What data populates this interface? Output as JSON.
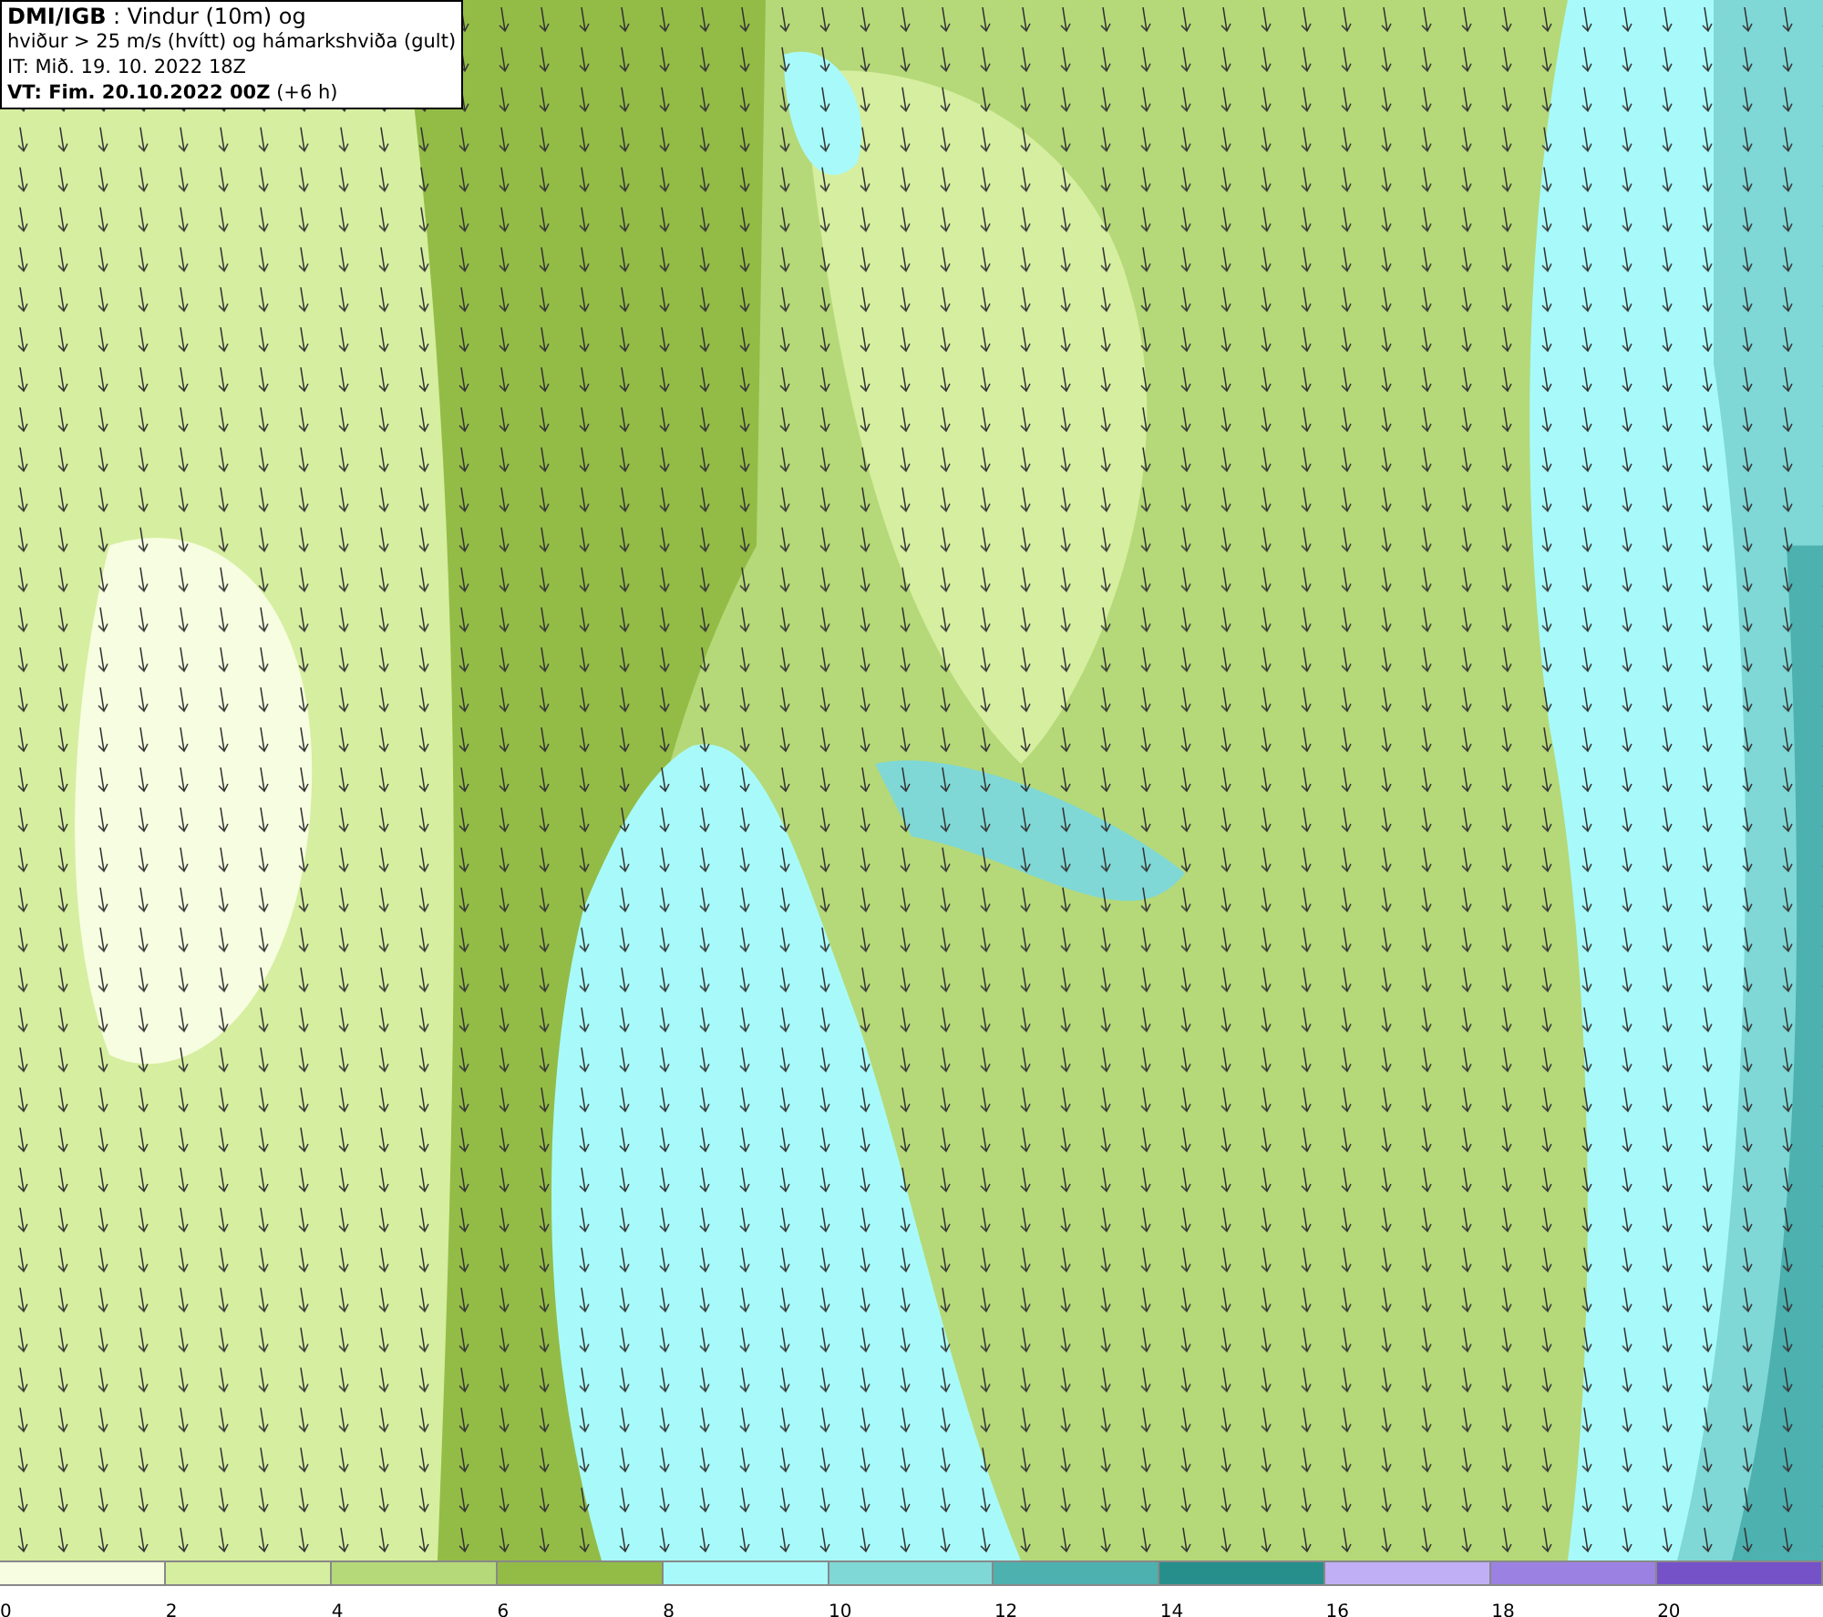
{
  "info_box": {
    "lines": [
      "**DMI/IGB** : Vindur (10m) og",
      "hviður > 25 m/s (hvítt) og hámarkshviða (gult)",
      "IT: Mið. 19. 10. 2022 18Z",
      "**VT: Fim. 20.10.2022 00Z** (+6 h)"
    ]
  },
  "legend": [
    {
      "label": "0",
      "color": "#f7fde0"
    },
    {
      "label": "2",
      "color": "#d6eea0"
    },
    {
      "label": "4",
      "color": "#b5d978"
    },
    {
      "label": "6",
      "color": "#93bc47"
    },
    {
      "label": "8",
      "color": "#a8fafa"
    },
    {
      "label": "10",
      "color": "#7fd8d6"
    },
    {
      "label": "12",
      "color": "#4db1b0"
    },
    {
      "label": "14",
      "color": "#268f8c"
    },
    {
      "label": "16",
      "color": "#c0aff5"
    },
    {
      "label": "18",
      "color": "#9b82e2"
    },
    {
      "label": "20",
      "color": "#7552c8"
    }
  ]
}
